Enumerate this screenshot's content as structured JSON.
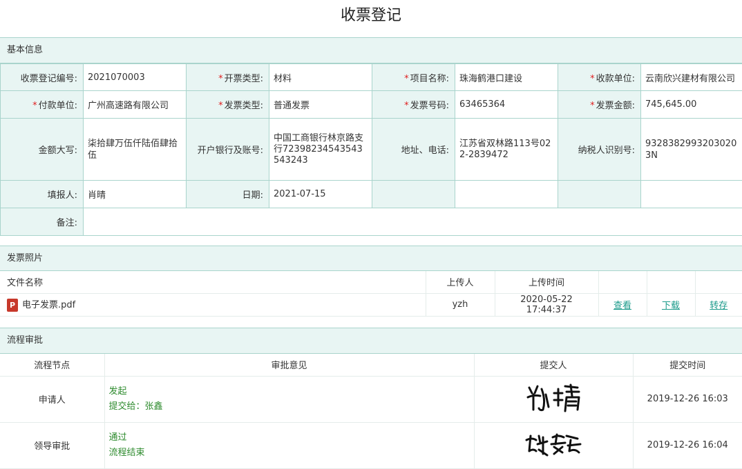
{
  "title": "收票登记",
  "basic": {
    "section_title": "基本信息",
    "receipt_no_label": "收票登记编号:",
    "receipt_no": "2021070003",
    "invoice_kind_label": "开票类型:",
    "invoice_kind": "材料",
    "project_label": "项目名称:",
    "project": "珠海鹤港口建设",
    "payee_label": "收款单位:",
    "payee": "云南欣兴建材有限公司",
    "payer_label": "付款单位:",
    "payer": "广州高速路有限公司",
    "invoice_type_label": "发票类型:",
    "invoice_type": "普通发票",
    "invoice_no_label": "发票号码:",
    "invoice_no": "63465364",
    "amount_label": "发票金额:",
    "amount": "745,645.00",
    "amount_cn_label": "金额大写:",
    "amount_cn": "柒拾肆万伍仟陆佰肆拾伍",
    "bank_label": "开户银行及账号:",
    "bank": "中国工商银行林京路支行72398234543543543243",
    "address_label": "地址、电话:",
    "address": "江苏省双林路113号022-2839472",
    "taxid_label": "纳税人识别号:",
    "taxid": "93283829932030203N",
    "filler_label": "填报人:",
    "filler": "肖晴",
    "date_label": "日期:",
    "date": "2021-07-15",
    "remark_label": "备注:",
    "remark": ""
  },
  "photos": {
    "section_title": "发票照片",
    "headers": {
      "name": "文件名称",
      "uploader": "上传人",
      "time": "上传时间"
    },
    "files": [
      {
        "icon": "P",
        "name": "电子发票.pdf",
        "uploader": "yzh",
        "time": "2020-05-22 17:44:37",
        "view": "查看",
        "download": "下载",
        "forward": "转存"
      }
    ]
  },
  "flow": {
    "section_title": "流程审批",
    "headers": {
      "node": "流程节点",
      "opinion": "审批意见",
      "submitter": "提交人",
      "time": "提交时间"
    },
    "rows": [
      {
        "node": "申请人",
        "opinion1": "发起",
        "opinion2": "提交给：张鑫",
        "signature": "肖晴",
        "time": "2019-12-26 16:03"
      },
      {
        "node": "领导审批",
        "opinion1": "通过",
        "opinion2": "流程结束",
        "signature": "张鑫",
        "time": "2019-12-26 16:04"
      }
    ]
  }
}
